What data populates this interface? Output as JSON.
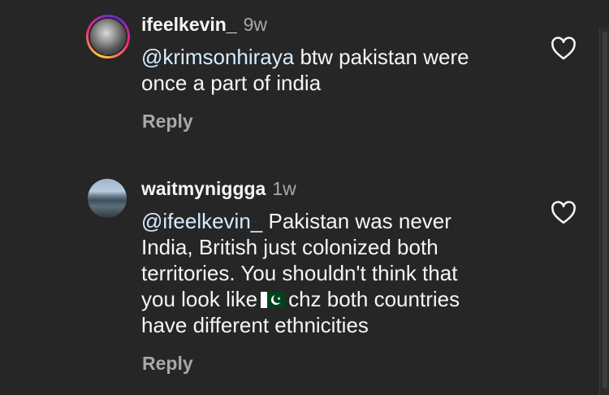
{
  "comments": [
    {
      "username": "ifeelkevin_",
      "time": "9w",
      "mention": "@krimsonhiraya",
      "text_lines": [
        "btw pakistan were",
        "once a part of india"
      ],
      "reply_label": "Reply",
      "avatar_icon": "profile-photo-bw",
      "like_icon": "heart-outline-icon"
    },
    {
      "username": "waitmyniggga",
      "time": "1w",
      "mention": "@ifeelkevin_",
      "line1_rest": "Pakistan was never",
      "line2": "India, British just colonized both",
      "line3": "territories. You shouldn't think that",
      "line4_before_flag": "you look like",
      "flag_icon": "pakistan-flag-emoji",
      "line4_after_flag": "chz both countries",
      "line5": "have different ethnicities",
      "reply_label": "Reply",
      "avatar_icon": "profile-photo-mountain-lake",
      "like_icon": "heart-outline-icon"
    }
  ],
  "colors": {
    "background": "#262626",
    "primary_text": "#f5f5f5",
    "secondary_text": "#a8a8a8"
  }
}
